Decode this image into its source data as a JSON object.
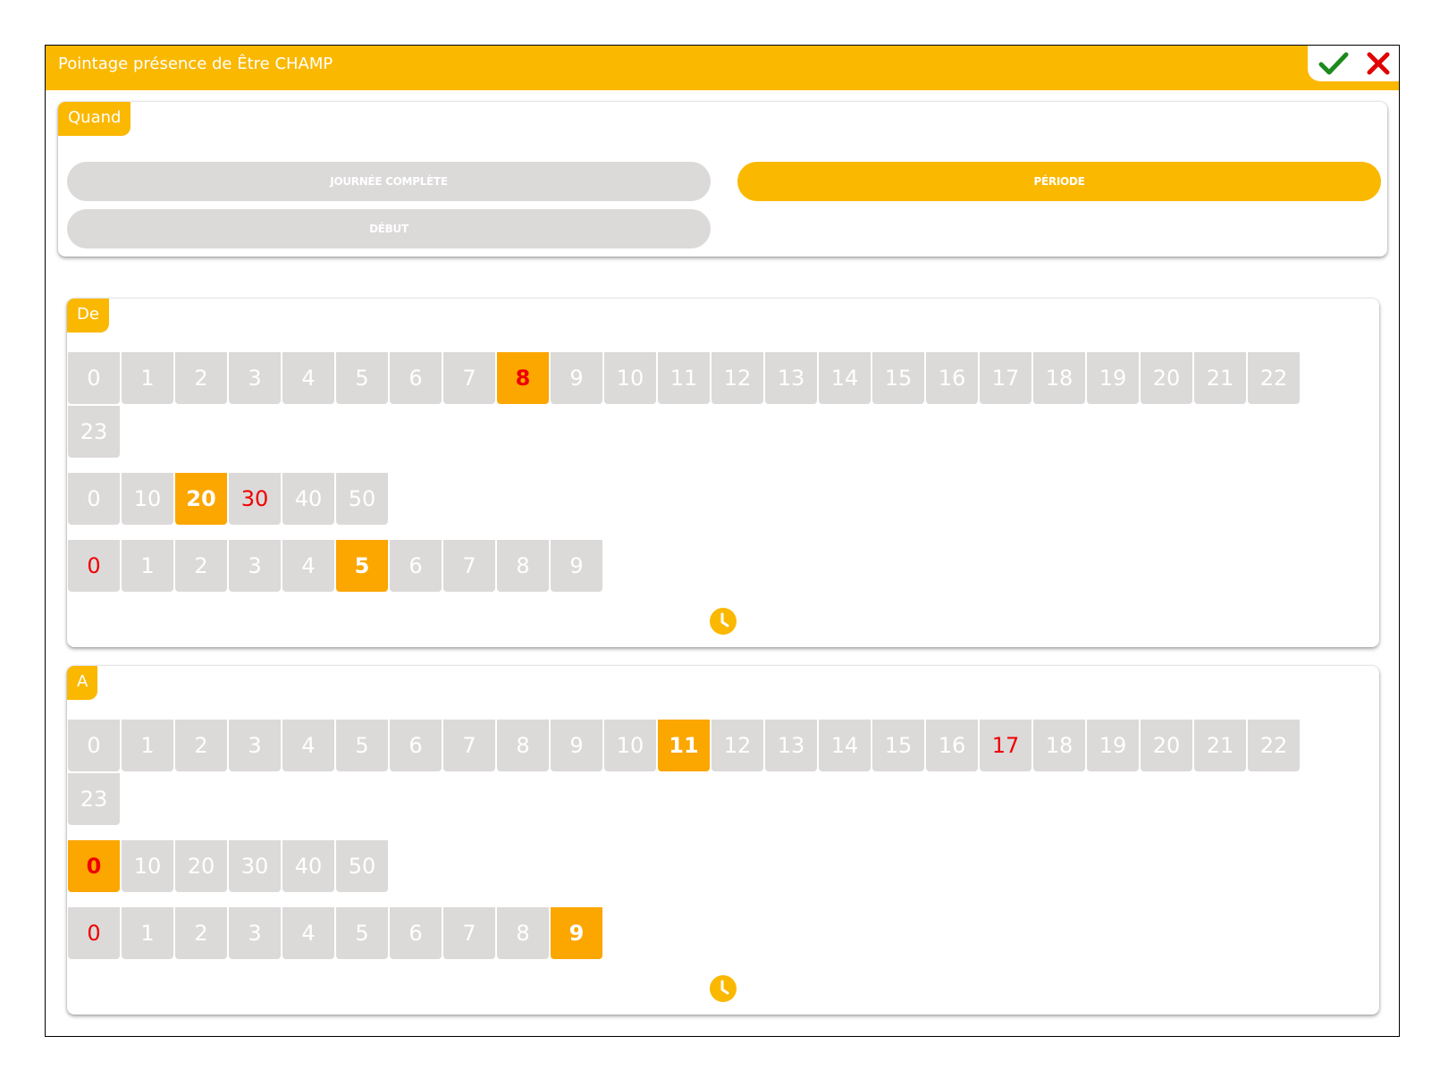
{
  "dialog": {
    "title": "Pointage présence de Être CHAMP",
    "confirm_icon": "check-icon",
    "cancel_icon": "close-icon",
    "confirm_color": "#1e8a1e",
    "cancel_color": "#e00000"
  },
  "quand": {
    "label": "Quand",
    "options": [
      {
        "label": "JOURNÉE COMPLÈTE",
        "active": false
      },
      {
        "label": "PÉRIODE",
        "active": true
      },
      {
        "label": "DÉBUT",
        "active": false
      }
    ]
  },
  "de": {
    "label": "De",
    "hours": {
      "values": [
        "0",
        "1",
        "2",
        "3",
        "4",
        "5",
        "6",
        "7",
        "8",
        "9",
        "10",
        "11",
        "12",
        "13",
        "14",
        "15",
        "16",
        "17",
        "18",
        "19",
        "20",
        "21",
        "22",
        "23"
      ],
      "selected": "8",
      "red": [
        "8"
      ]
    },
    "tens": {
      "values": [
        "0",
        "10",
        "20",
        "30",
        "40",
        "50"
      ],
      "selected": "20",
      "red": [
        "30"
      ]
    },
    "units": {
      "values": [
        "0",
        "1",
        "2",
        "3",
        "4",
        "5",
        "6",
        "7",
        "8",
        "9"
      ],
      "selected": "5",
      "red": [
        "0"
      ]
    },
    "clock_icon": "clock-icon"
  },
  "a": {
    "label": "A",
    "hours": {
      "values": [
        "0",
        "1",
        "2",
        "3",
        "4",
        "5",
        "6",
        "7",
        "8",
        "9",
        "10",
        "11",
        "12",
        "13",
        "14",
        "15",
        "16",
        "17",
        "18",
        "19",
        "20",
        "21",
        "22",
        "23"
      ],
      "selected": "11",
      "red": [
        "17"
      ]
    },
    "tens": {
      "values": [
        "0",
        "10",
        "20",
        "30",
        "40",
        "50"
      ],
      "selected": "0",
      "red": [
        "0"
      ]
    },
    "units": {
      "values": [
        "0",
        "1",
        "2",
        "3",
        "4",
        "5",
        "6",
        "7",
        "8",
        "9"
      ],
      "selected": "9",
      "red": [
        "0"
      ]
    },
    "clock_icon": "clock-icon"
  },
  "colors": {
    "accent": "#fbb800",
    "selected_cell": "#fca600",
    "inactive": "#dcd9d9",
    "warning_text": "#ee0000"
  }
}
